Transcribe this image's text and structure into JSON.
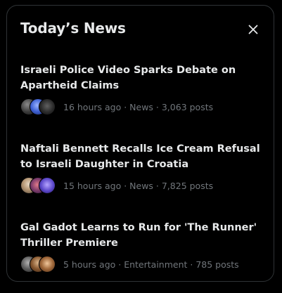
{
  "widget": {
    "title": "Today’s News",
    "close_icon": "close-icon"
  },
  "colors": {
    "background": "#000000",
    "border": "#2f3336",
    "text_primary": "#e7e9ea",
    "text_secondary": "#71767b"
  },
  "news": [
    {
      "headline": "Israeli Police Video Sparks Debate on Apartheid Claims",
      "meta": "16 hours ago · News · 3,063 posts",
      "avatars": [
        "avatar-1",
        "avatar-2",
        "avatar-3"
      ]
    },
    {
      "headline": "Naftali Bennett Recalls Ice Cream Refusal to Israeli Daughter in Croatia",
      "meta": "15 hours ago · News · 7,825 posts",
      "avatars": [
        "avatar-1",
        "avatar-2",
        "avatar-3"
      ]
    },
    {
      "headline": "Gal Gadot Learns to Run for 'The Runner' Thriller Premiere",
      "meta": "5 hours ago · Entertainment · 785 posts",
      "avatars": [
        "avatar-1",
        "avatar-2",
        "avatar-3"
      ]
    }
  ]
}
